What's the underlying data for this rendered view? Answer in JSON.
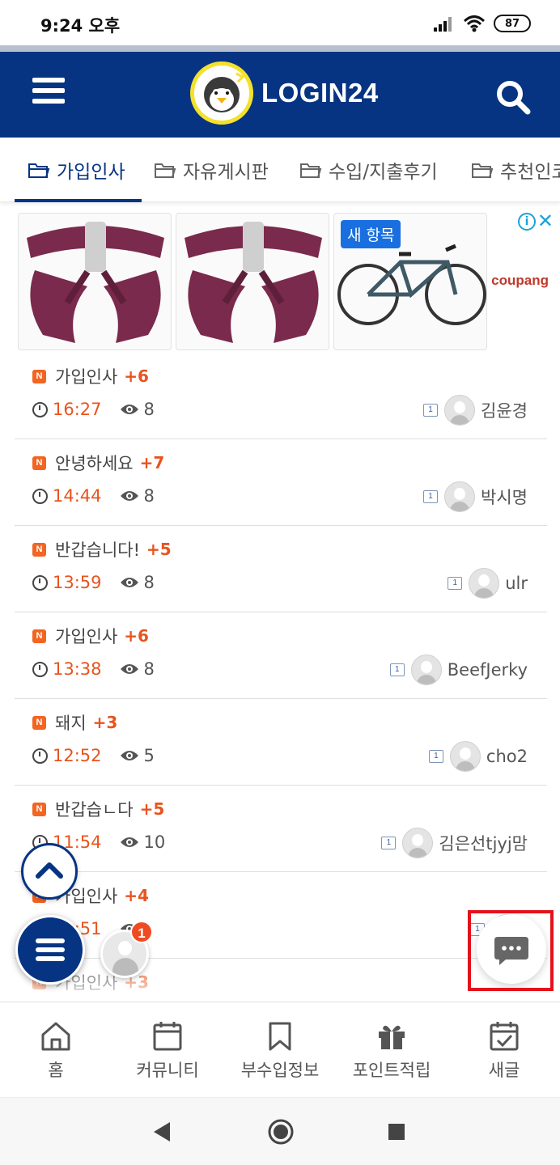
{
  "status_bar": {
    "time": "9:24 오후",
    "battery": "87"
  },
  "header": {
    "logo_text": "LOGIN24",
    "accent_color": "#063482"
  },
  "tabs": [
    {
      "label": "가입인사",
      "active": true
    },
    {
      "label": "자유게시판",
      "active": false
    },
    {
      "label": "수입/지출후기",
      "active": false
    },
    {
      "label": "추천인코드",
      "active": false
    }
  ],
  "ad": {
    "badge": "새 항목",
    "brand": "coupang",
    "close": "✕",
    "info": "i"
  },
  "posts": [
    {
      "title": "가입인사",
      "comments": "+6",
      "time": "16:27",
      "views": "8",
      "level": "1",
      "author": "김윤경"
    },
    {
      "title": "안녕하세요",
      "comments": "+7",
      "time": "14:44",
      "views": "8",
      "level": "1",
      "author": "박시명"
    },
    {
      "title": "반갑습니다!",
      "comments": "+5",
      "time": "13:59",
      "views": "8",
      "level": "1",
      "author": "ulr"
    },
    {
      "title": "가입인사",
      "comments": "+6",
      "time": "13:38",
      "views": "8",
      "level": "1",
      "author": "BeefJerky"
    },
    {
      "title": "돼지",
      "comments": "+3",
      "time": "12:52",
      "views": "5",
      "level": "1",
      "author": "cho2"
    },
    {
      "title": "반갑습ㄴ다",
      "comments": "+5",
      "time": "11:54",
      "views": "10",
      "level": "1",
      "author": "김은선tjyj맘"
    },
    {
      "title": "가입인사",
      "comments": "+4",
      "time": "11:51",
      "views": "",
      "level": "1",
      "author": ""
    },
    {
      "title": "가입인사",
      "comments": "+3",
      "time": "",
      "views": "",
      "level": "",
      "author": ""
    }
  ],
  "floating": {
    "notification_count": "1"
  },
  "bottom_nav": [
    {
      "label": "홈",
      "icon": "home-icon"
    },
    {
      "label": "커뮤니티",
      "icon": "calendar-icon"
    },
    {
      "label": "부수입정보",
      "icon": "bookmark-icon"
    },
    {
      "label": "포인트적립",
      "icon": "gift-icon"
    },
    {
      "label": "새글",
      "icon": "calendar-check-icon"
    }
  ]
}
